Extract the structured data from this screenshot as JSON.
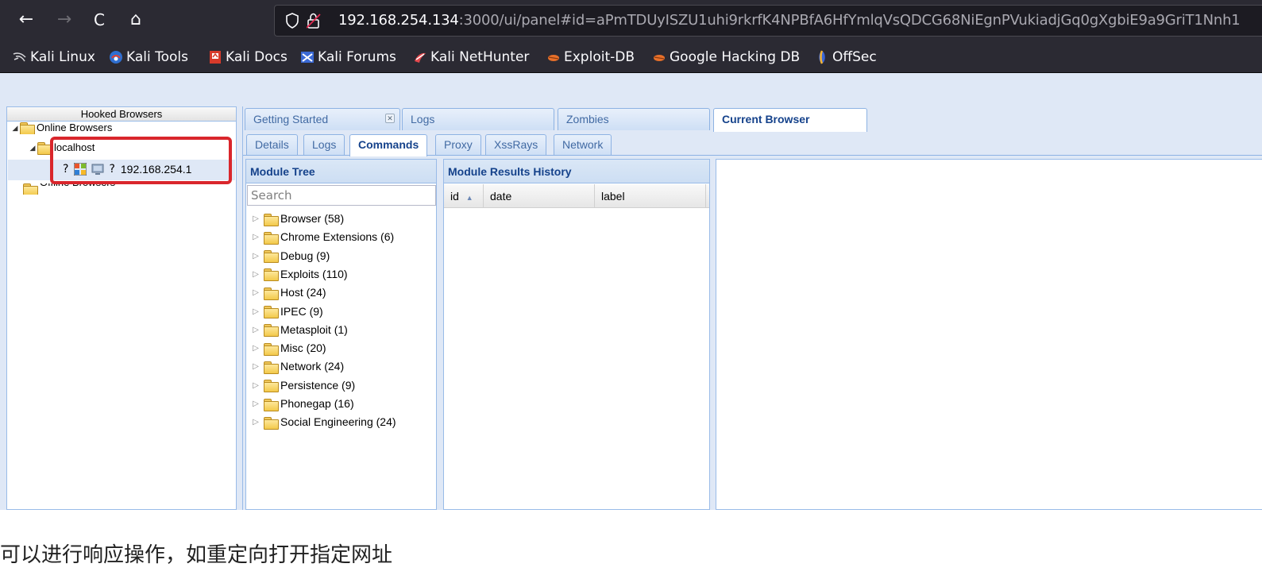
{
  "browser": {
    "nav": {
      "back": "←",
      "forward": "→",
      "reload": "C",
      "home": "⌂"
    },
    "url": {
      "host": "192.168.254.134",
      "rest": ":3000/ui/panel#id=aPmTDUyISZU1uhi9rkrfK4NPBfA6HfYmlqVsQDCG68NiEgnPVukiadjGq0gXgbiE9a9GriT1Nnh1"
    },
    "bookmarks": [
      {
        "label": "Kali Linux",
        "icon": "kali-dragon-icon"
      },
      {
        "label": "Kali Tools",
        "icon": "kali-tools-icon"
      },
      {
        "label": "Kali Docs",
        "icon": "kali-docs-icon"
      },
      {
        "label": "Kali Forums",
        "icon": "kali-forums-icon"
      },
      {
        "label": "Kali NetHunter",
        "icon": "nethunter-icon"
      },
      {
        "label": "Exploit-DB",
        "icon": "exploit-db-icon"
      },
      {
        "label": "Google Hacking DB",
        "icon": "ghdb-icon"
      },
      {
        "label": "OffSec",
        "icon": "offsec-icon"
      }
    ]
  },
  "hooked_browsers": {
    "title": "Hooked Browsers",
    "online_label": "Online Browsers",
    "host_label": "localhost",
    "browser_ip": "192.168.254.1",
    "browser_icons": [
      "?",
      "windows-icon",
      "monitor-icon",
      "?"
    ],
    "offline_label": "Offline Browsers"
  },
  "main_tabs": [
    {
      "label": "Getting Started",
      "closable": true
    },
    {
      "label": "Logs"
    },
    {
      "label": "Zombies"
    },
    {
      "label": "Current Browser",
      "active": true
    }
  ],
  "sub_tabs": [
    {
      "label": "Details"
    },
    {
      "label": "Logs"
    },
    {
      "label": "Commands",
      "active": true
    },
    {
      "label": "Proxy"
    },
    {
      "label": "XssRays"
    },
    {
      "label": "Network"
    }
  ],
  "module_tree": {
    "title": "Module Tree",
    "search_placeholder": "Search",
    "items": [
      "Browser (58)",
      "Chrome Extensions (6)",
      "Debug (9)",
      "Exploits (110)",
      "Host (24)",
      "IPEC (9)",
      "Metasploit (1)",
      "Misc (20)",
      "Network (24)",
      "Persistence (9)",
      "Phonegap (16)",
      "Social Engineering (24)"
    ]
  },
  "results_history": {
    "title": "Module Results History",
    "columns": [
      "id",
      "date",
      "label"
    ],
    "sort_indicator": "▲"
  },
  "caption": "可以进行响应操作，如重定向打开指定网址",
  "colors": {
    "highlight_box": "#d9262c",
    "panel_header": "#15428b",
    "chrome_bg": "#2b2a33"
  }
}
